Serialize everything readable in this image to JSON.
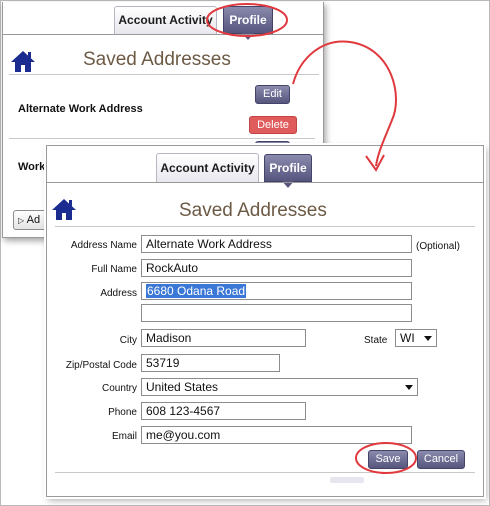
{
  "back_window": {
    "tabs": {
      "account_activity": "Account Activity",
      "profile": "Profile"
    },
    "title": "Saved Addresses",
    "entry_name": "Alternate Work Address",
    "edit_label": "Edit",
    "delete_label": "Delete",
    "second_entry_fragment": "Work",
    "add_fragment": "Ad"
  },
  "front_window": {
    "tabs": {
      "account_activity": "Account Activity",
      "profile": "Profile"
    },
    "title": "Saved Addresses",
    "fields": {
      "address_name": {
        "label": "Address Name",
        "value": "Alternate Work Address",
        "note": "(Optional)"
      },
      "full_name": {
        "label": "Full Name",
        "value": "RockAuto"
      },
      "address": {
        "label": "Address",
        "line1": "6680 Odana Road",
        "line2": ""
      },
      "city": {
        "label": "City",
        "value": "Madison"
      },
      "state": {
        "label": "State",
        "value": "WI"
      },
      "zip": {
        "label": "Zip/Postal Code",
        "value": "53719"
      },
      "country": {
        "label": "Country",
        "value": "United States"
      },
      "phone": {
        "label": "Phone",
        "value": "608 123-4567"
      },
      "email": {
        "label": "Email",
        "value": "me@you.com"
      }
    },
    "save_label": "Save",
    "cancel_label": "Cancel"
  },
  "colors": {
    "annotation": "#e0393e",
    "tab_active": "#5d5d87",
    "title_brown": "#6c5a45",
    "delete_red": "#e05b5b",
    "home_blue": "#1b2b8f",
    "selection_blue": "#3b77d6"
  },
  "icons": {
    "home": "home-icon",
    "triangle": "play-triangle-icon"
  }
}
